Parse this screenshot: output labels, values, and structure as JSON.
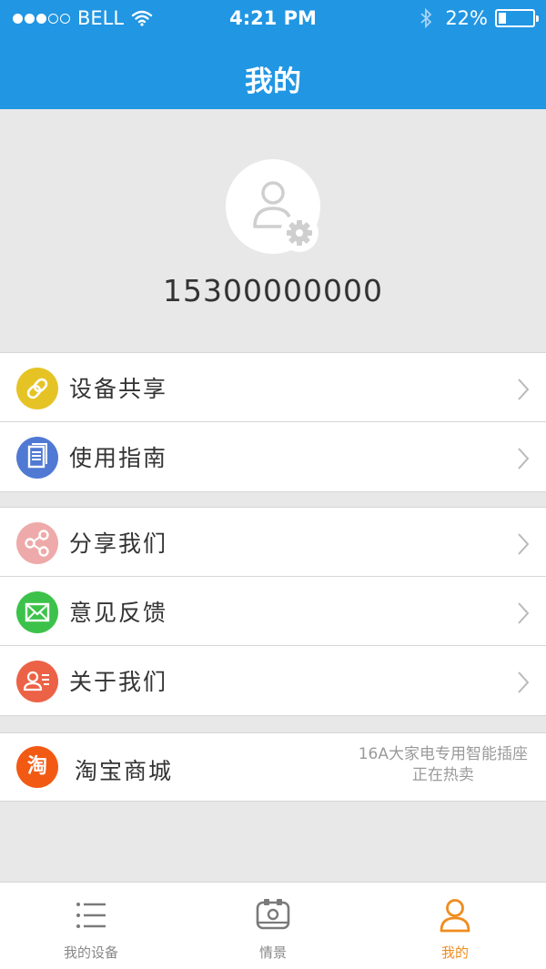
{
  "status_bar": {
    "carrier": "BELL",
    "time": "4:21 PM",
    "battery_percent": "22%",
    "battery_level": 0.22,
    "signal_bars": 3
  },
  "header": {
    "title": "我的"
  },
  "profile": {
    "phone": "15300000000"
  },
  "menu_group_1": [
    {
      "label": "设备共享",
      "icon": "link-icon",
      "color": "#e6c325"
    },
    {
      "label": "使用指南",
      "icon": "book-icon",
      "color": "#4f79d3"
    }
  ],
  "menu_group_2": [
    {
      "label": "分享我们",
      "icon": "share-icon",
      "color": "#eeaaaa"
    },
    {
      "label": "意见反馈",
      "icon": "mail-icon",
      "color": "#3cc24a"
    },
    {
      "label": "关于我们",
      "icon": "contact-card-icon",
      "color": "#ec6246"
    }
  ],
  "taobao": {
    "icon_text": "淘",
    "label": "淘宝商城",
    "promo_line1": "16A大家电专用智能插座",
    "promo_line2": "正在热卖",
    "color": "#f25a14"
  },
  "tabbar": {
    "tabs": [
      {
        "label": "我的设备",
        "icon": "list-icon"
      },
      {
        "label": "情景",
        "icon": "scene-icon"
      },
      {
        "label": "我的",
        "icon": "person-icon",
        "active": true
      }
    ],
    "active_color": "#f08c1e",
    "inactive_color": "#888888"
  },
  "colors": {
    "header_bg": "#2196e3",
    "page_bg": "#e8e8e8"
  }
}
